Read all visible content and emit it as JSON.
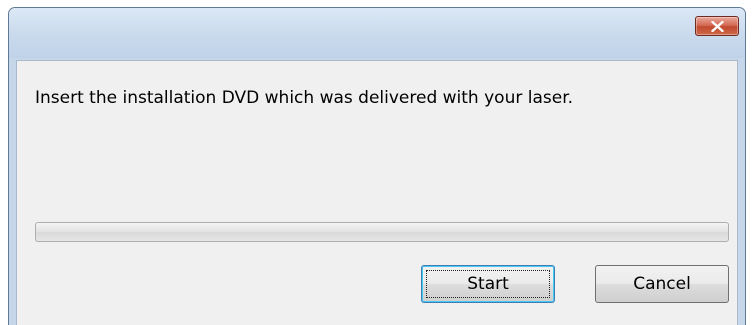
{
  "window": {
    "title": "",
    "close_icon": "close-x-icon"
  },
  "dialog": {
    "message": "Insert the installation DVD which was delivered with your laser."
  },
  "progress": {
    "value_percent": 0
  },
  "buttons": {
    "start_label": "Start",
    "cancel_label": "Cancel"
  },
  "colors": {
    "titlebar": "#c9daed",
    "close_button": "#c7503a",
    "client_background": "#f0f0f0",
    "default_button_border": "#3c7fb1"
  }
}
